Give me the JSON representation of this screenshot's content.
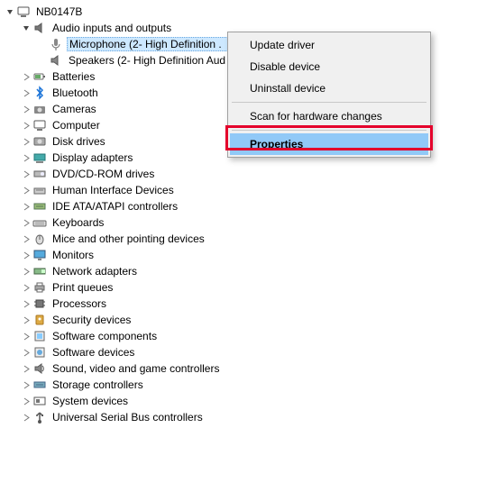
{
  "root": {
    "label": "NB0147B"
  },
  "audio": {
    "label": "Audio inputs and outputs",
    "mic": "Microphone (2- High Definition .",
    "speakers": "Speakers (2- High Definition Aud"
  },
  "cats": {
    "batteries": "Batteries",
    "bluetooth": "Bluetooth",
    "cameras": "Cameras",
    "computer": "Computer",
    "diskdrives": "Disk drives",
    "display": "Display adapters",
    "dvd": "DVD/CD-ROM drives",
    "hid": "Human Interface Devices",
    "ide": "IDE ATA/ATAPI controllers",
    "keyboards": "Keyboards",
    "mice": "Mice and other pointing devices",
    "monitors": "Monitors",
    "netadapters": "Network adapters",
    "printq": "Print queues",
    "processors": "Processors",
    "security": "Security devices",
    "swcomp": "Software components",
    "swdev": "Software devices",
    "sound": "Sound, video and game controllers",
    "storagectrl": "Storage controllers",
    "sysdev": "System devices",
    "usb": "Universal Serial Bus controllers"
  },
  "menu": {
    "update": "Update driver",
    "disable": "Disable device",
    "uninstall": "Uninstall device",
    "scan": "Scan for hardware changes",
    "properties": "Properties"
  }
}
